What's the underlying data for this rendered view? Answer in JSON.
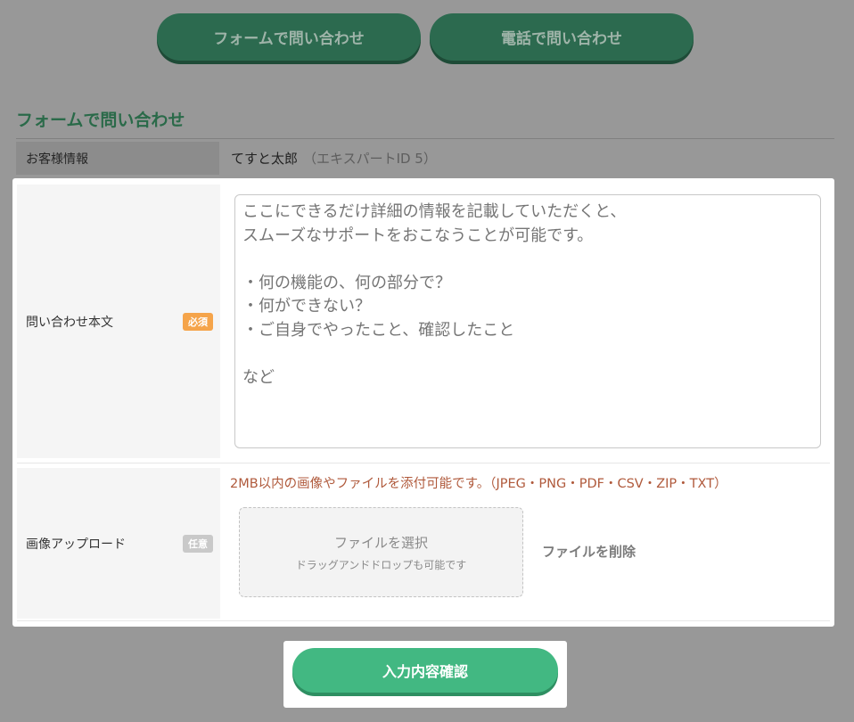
{
  "tabs": {
    "form_label": "フォームで問い合わせ",
    "phone_label": "電話で問い合わせ"
  },
  "section": {
    "title": "フォームで問い合わせ"
  },
  "customer": {
    "label": "お客様情報",
    "name": "てすと太郎",
    "expert_id": "（エキスパートID 5）"
  },
  "inquiry": {
    "label": "問い合わせ本文",
    "badge": "必須",
    "placeholder": "ここにできるだけ詳細の情報を記載していただくと、\nスムーズなサポートをおこなうことが可能です。\n\n・何の機能の、何の部分で？\n・何ができない？\n・ご自身でやったこと、確認したこと\n\nなど"
  },
  "upload": {
    "label": "画像アップロード",
    "badge": "任意",
    "note": "2MB以内の画像やファイルを添付可能です。（JPEG・PNG・PDF・CSV・ZIP・TXT）",
    "select_label": "ファイルを選択",
    "drag_hint": "ドラッグアンドドロップも可能です",
    "delete_label": "ファイルを削除"
  },
  "submit": {
    "label": "入力内容確認"
  },
  "colors": {
    "tab_green": "#2c6a4f",
    "submit_green": "#42b882",
    "required_badge": "#f5a44a",
    "optional_badge": "#c9c9c9",
    "note_text": "#b05a3c"
  }
}
